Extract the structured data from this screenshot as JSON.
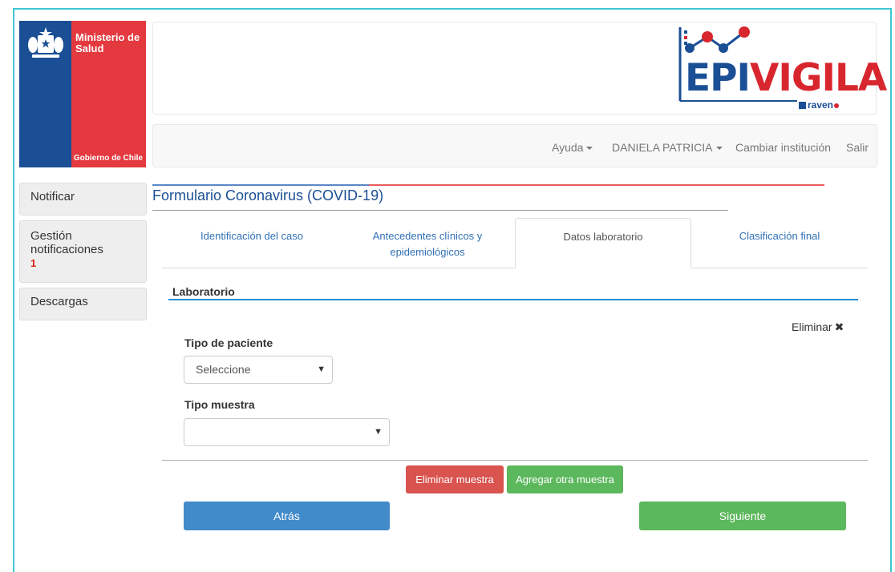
{
  "brand": {
    "ministry": "Ministerio de Salud",
    "government": "Gobierno de Chile",
    "app_logo_part1": "EPI",
    "app_logo_part2": "VIGILA",
    "partner_logo": "raven"
  },
  "navbar": {
    "help": "Ayuda",
    "user": "DANIELA PATRICIA",
    "change_institution": "Cambiar institución",
    "logout": "Salir"
  },
  "sidebar": {
    "items": [
      {
        "label": "Notificar"
      },
      {
        "label": "Gestión notificaciones",
        "badge": "1"
      },
      {
        "label": "Descargas"
      }
    ]
  },
  "form": {
    "title": "Formulario Coronavirus (COVID-19)",
    "tabs": [
      {
        "label": "Identificación del caso"
      },
      {
        "label": "Antecedentes clínicos y epidemiológicos"
      },
      {
        "label": "Datos laboratorio",
        "active": true
      },
      {
        "label": "Clasificación final"
      }
    ],
    "section_title": "Laboratorio",
    "remove_label": "Eliminar",
    "patient_type": {
      "label": "Tipo de paciente",
      "value": "Seleccione"
    },
    "sample_type": {
      "label": "Tipo muestra",
      "value": ""
    },
    "buttons": {
      "remove_sample": "Eliminar muestra",
      "add_sample": "Agregar otra muestra",
      "back": "Atrás",
      "next": "Siguiente"
    }
  },
  "colors": {
    "gov_blue": "#1b4f95",
    "gov_red": "#e3393f",
    "tab_link": "#3070b5",
    "danger": "#d9534f",
    "success": "#5cb85c",
    "primary": "#428bca",
    "frame": "#3ec7d0"
  }
}
